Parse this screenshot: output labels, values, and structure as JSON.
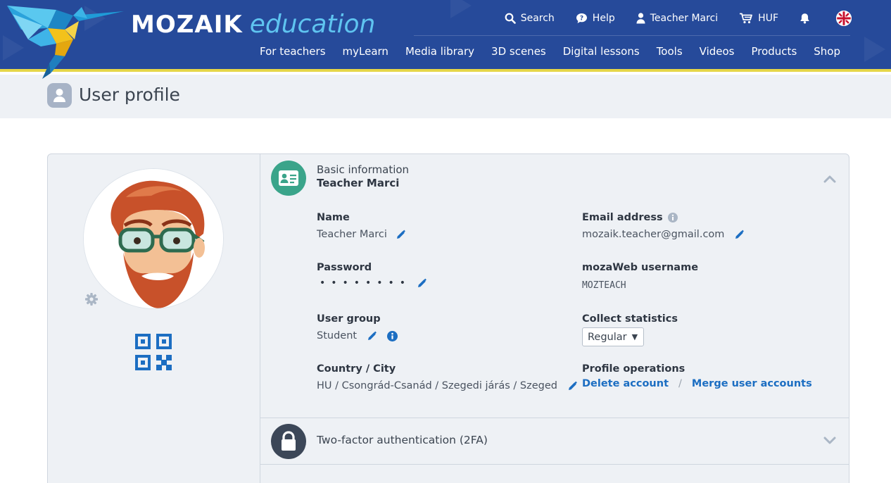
{
  "brand": {
    "logo_main": "MOZAIK",
    "logo_sub": "education"
  },
  "topbar": {
    "search_label": "Search",
    "help_label": "Help",
    "user_label": "Teacher Marci",
    "currency_label": "HUF"
  },
  "nav": {
    "items": [
      "For teachers",
      "myLearn",
      "Media library",
      "3D scenes",
      "Digital lessons",
      "Tools",
      "Videos",
      "Products",
      "Shop"
    ]
  },
  "page": {
    "title": "User profile"
  },
  "basic_info": {
    "caption": "Basic information",
    "user_name": "Teacher Marci",
    "name_label": "Name",
    "name_value": "Teacher Marci",
    "email_label": "Email address",
    "email_value": "mozaik.teacher@gmail.com",
    "password_label": "Password",
    "password_value": "••••••••",
    "username_label": "mozaWeb username",
    "username_value": "MOZTEACH",
    "group_label": "User group",
    "group_value": "Student",
    "stats_label": "Collect statistics",
    "stats_value": "Regular",
    "location_label": "Country / City",
    "location_value": "HU / Csongrád-Csanád / Szegedi járás / Szeged",
    "operations_label": "Profile operations",
    "delete_label": "Delete account",
    "separator": "/",
    "merge_label": "Merge user accounts"
  },
  "twofa": {
    "caption": "Two-factor authentication (2FA)"
  },
  "colors": {
    "header_bg": "#264a9a",
    "header_accent": "#e5d648",
    "link": "#1c6ec2",
    "basic_icon_bg": "#3aa48a",
    "lock_icon_bg": "#3c4758"
  },
  "icons": [
    "search-icon",
    "help-icon",
    "user-icon",
    "cart-icon",
    "bell-icon",
    "uk-flag-icon",
    "profile-icon",
    "id-card-icon",
    "lock-icon",
    "pencil-icon",
    "info-icon",
    "gear-icon",
    "qr-code-icon",
    "chevron-up-icon",
    "chevron-down-icon"
  ]
}
